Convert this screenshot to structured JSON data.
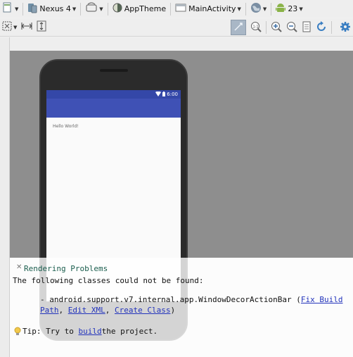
{
  "toolbar1": {
    "device_label": "Nexus 4",
    "theme_label": "AppTheme",
    "activity_label": "MainActivity",
    "api_label": "23"
  },
  "preview": {
    "status_time": "6:00",
    "hello_text": "Hello World!"
  },
  "problems": {
    "title": "Rendering Problems",
    "line1": "The following classes could not be found:",
    "class_prefix": "- android.support.v7.internal.app.WindowDecorActionBar (",
    "fix_link": "Fix Build Path",
    "sep1": ", ",
    "edit_link": "Edit XML",
    "sep2": ", ",
    "create_link": "Create Class",
    "suffix": ")",
    "tip_prefix": "Tip: Try to ",
    "tip_link": "build",
    "tip_suffix": " the project."
  },
  "colors": {
    "app_bar": "#3f51b5",
    "status_bar": "#3447a8",
    "canvas": "#8e8e8e",
    "link": "#2233bb",
    "title": "#1b5e4e"
  },
  "icons": [
    "layout-file-icon",
    "device-icon",
    "orientation-icon",
    "theme-icon",
    "activity-icon",
    "locale-icon",
    "android-api-icon",
    "zoom-to-fit-icon",
    "horizontal-fit-icon",
    "vertical-fit-icon",
    "toggle-mode-icon",
    "actual-size-icon",
    "zoom-in-icon",
    "zoom-out-icon",
    "screenshot-icon",
    "refresh-icon",
    "settings-icon"
  ]
}
